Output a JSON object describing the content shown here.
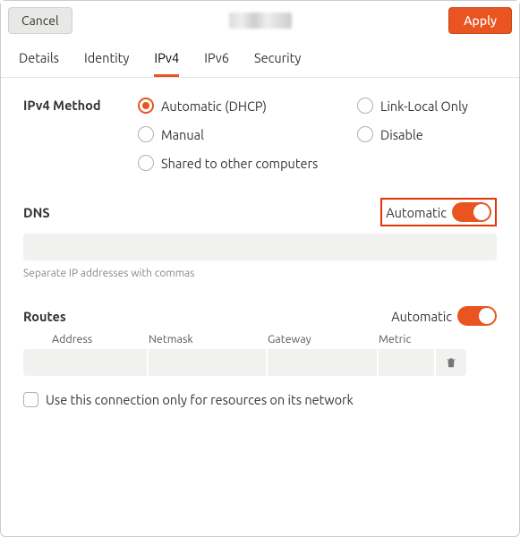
{
  "header": {
    "cancel": "Cancel",
    "apply": "Apply"
  },
  "tabs": {
    "details": "Details",
    "identity": "Identity",
    "ipv4": "IPv4",
    "ipv6": "IPv6",
    "security": "Security"
  },
  "method": {
    "label": "IPv4 Method",
    "auto_dhcp": "Automatic (DHCP)",
    "link_local": "Link-Local Only",
    "manual": "Manual",
    "disable": "Disable",
    "shared": "Shared to other computers"
  },
  "dns": {
    "label": "DNS",
    "toggle_label": "Automatic",
    "helper": "Separate IP addresses with commas",
    "value": ""
  },
  "routes": {
    "label": "Routes",
    "toggle_label": "Automatic",
    "cols": {
      "address": "Address",
      "netmask": "Netmask",
      "gateway": "Gateway",
      "metric": "Metric"
    }
  },
  "checkbox": {
    "label": "Use this connection only for resources on its network"
  }
}
